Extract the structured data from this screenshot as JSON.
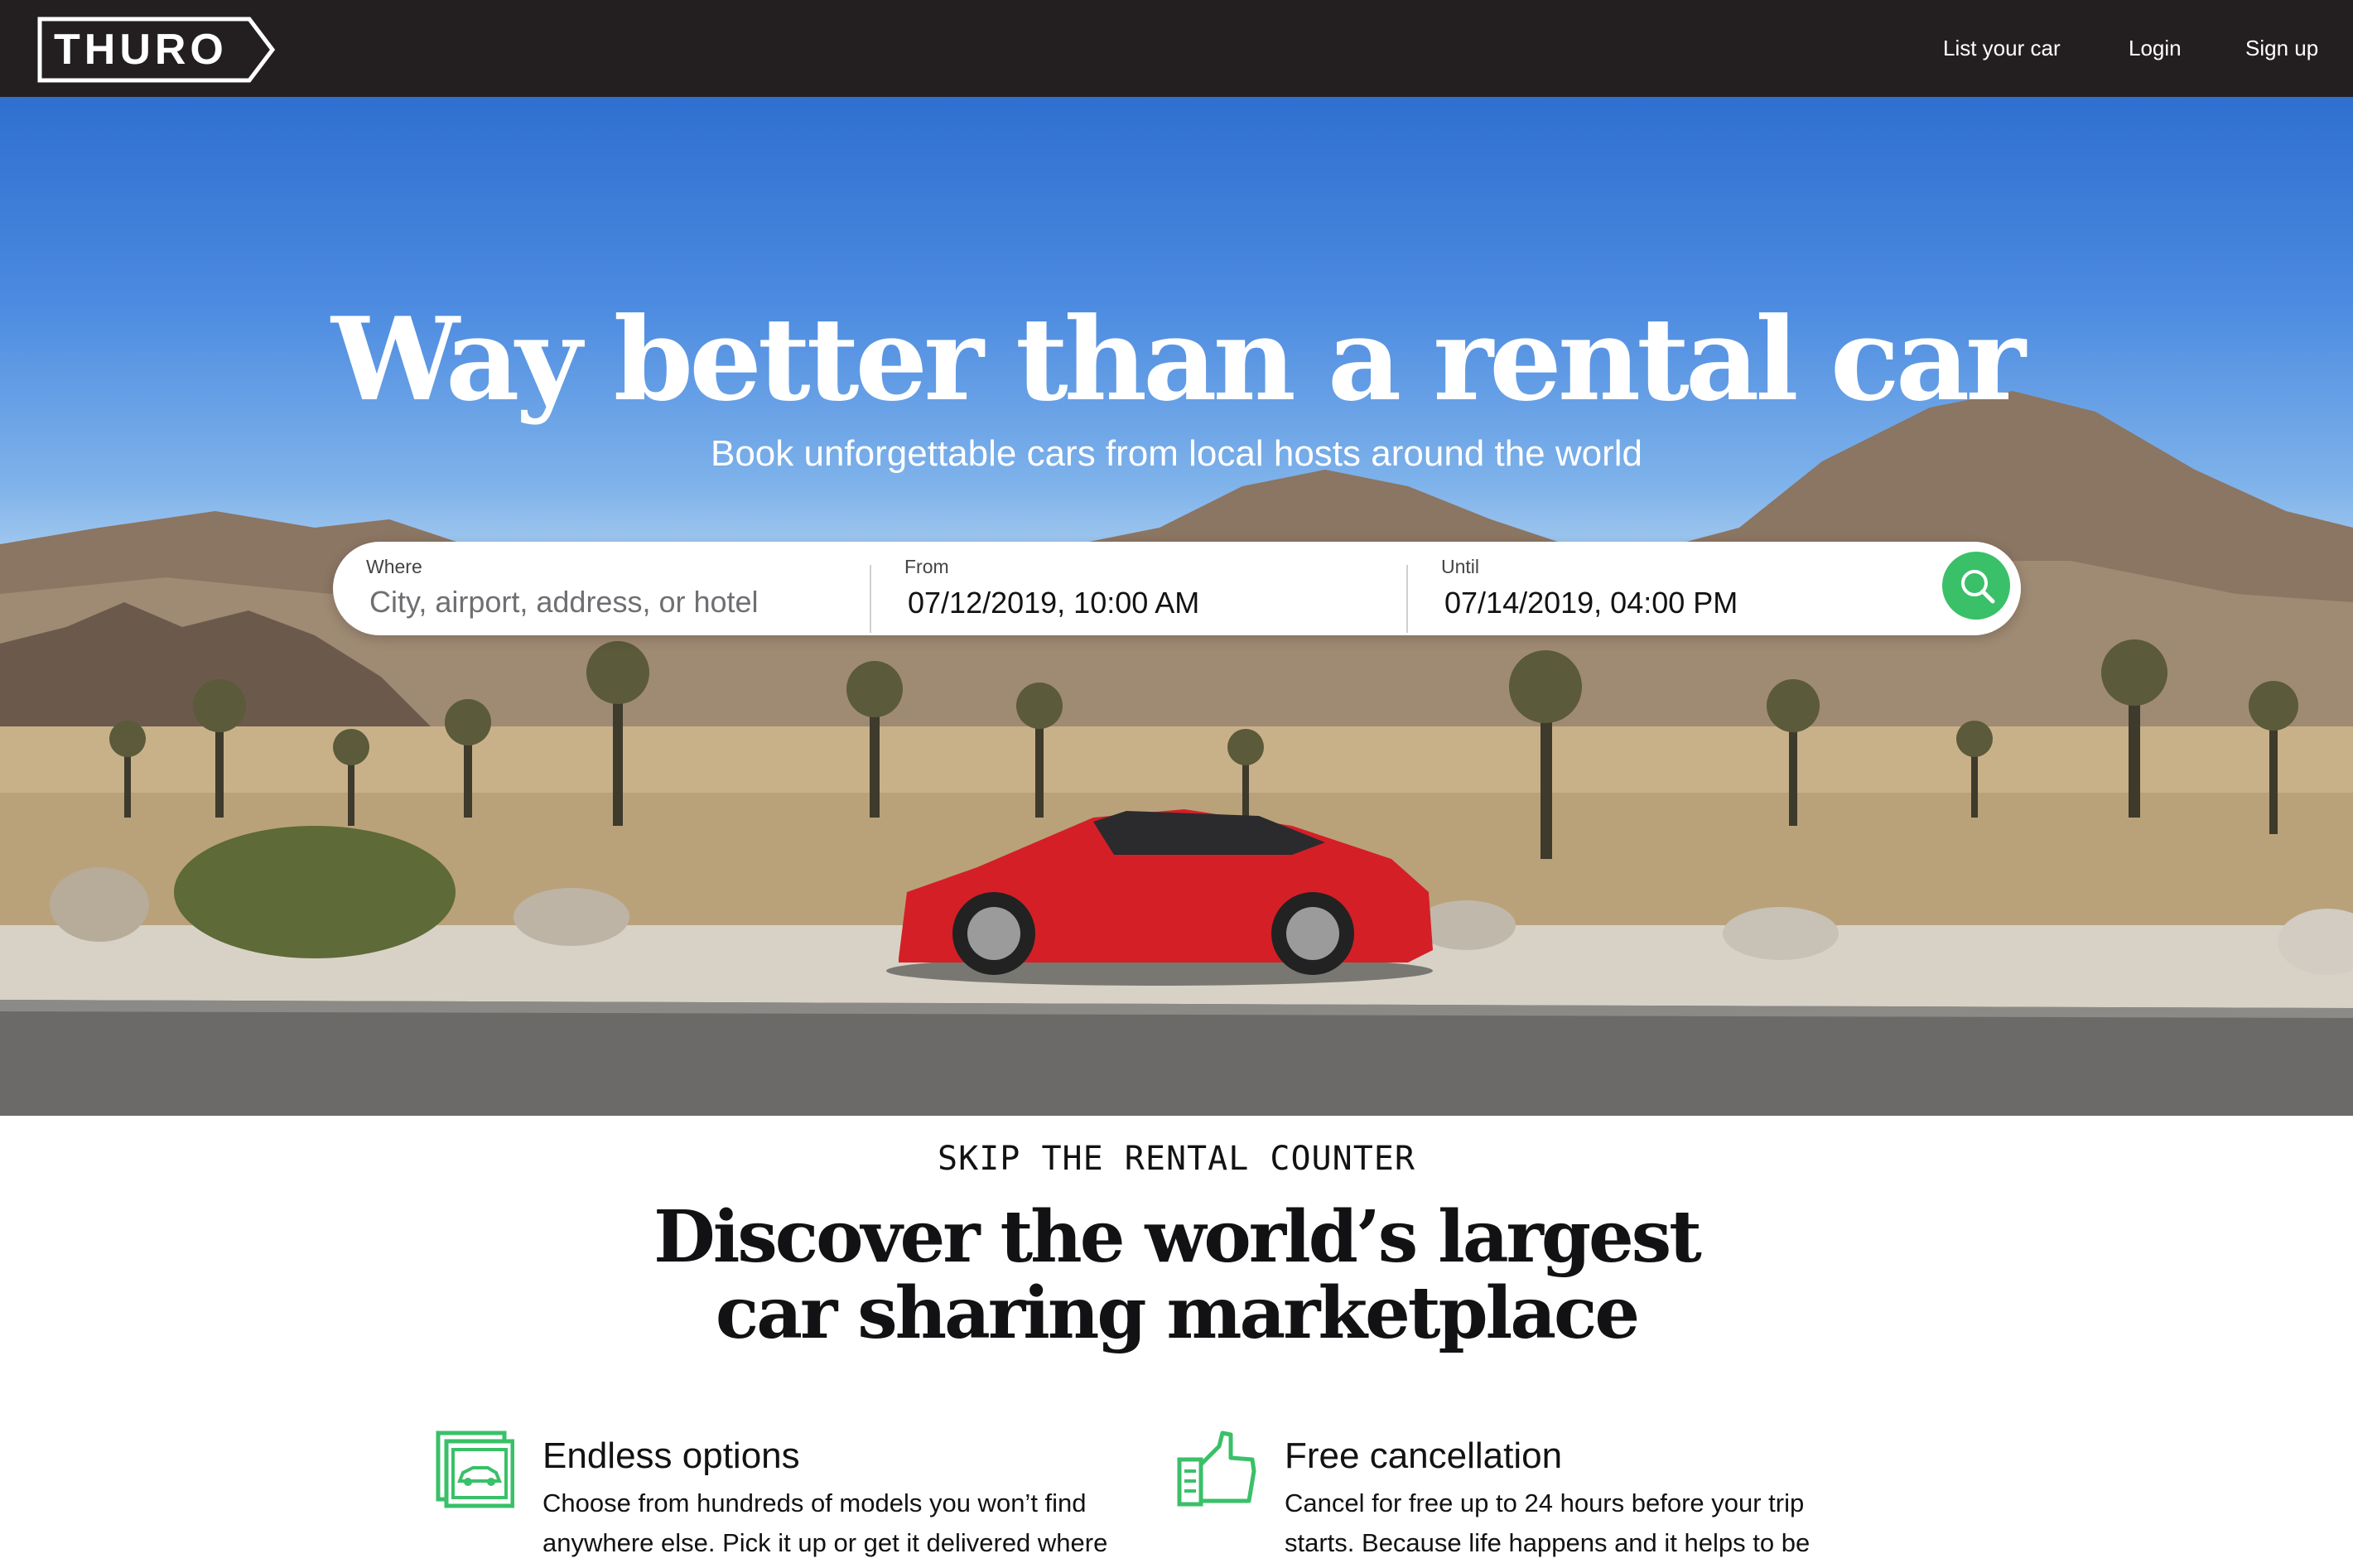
{
  "nav": {
    "logo": "THURO",
    "links": [
      "List your car",
      "Login",
      "Sign up"
    ]
  },
  "hero": {
    "title": "Way better than a rental car",
    "subtitle": "Book unforgettable cars from local hosts around the world"
  },
  "search": {
    "where_label": "Where",
    "where_placeholder": "City, airport, address, or hotel",
    "from_label": "From",
    "from_value": "07/12/2019, 10:00 AM",
    "until_label": "Until",
    "until_value": "07/14/2019, 04:00 PM"
  },
  "section": {
    "eyebrow": "SKIP THE RENTAL COUNTER",
    "heading_line1": "Discover the world’s largest",
    "heading_line2": "car sharing marketplace"
  },
  "features": [
    {
      "icon": "car-options-icon",
      "title": "Endless options",
      "line1": "Choose from hundreds of models you won’t find",
      "line2": "anywhere else. Pick it up or get it delivered where"
    },
    {
      "icon": "thumbs-up-icon",
      "title": "Free cancellation",
      "line1": "Cancel for free up to 24 hours before your trip",
      "line2": "starts. Because life happens and it helps to be"
    }
  ],
  "colors": {
    "nav_bg": "#231f20",
    "accent_green": "#3ac068",
    "sky": "#4b8ae0"
  }
}
